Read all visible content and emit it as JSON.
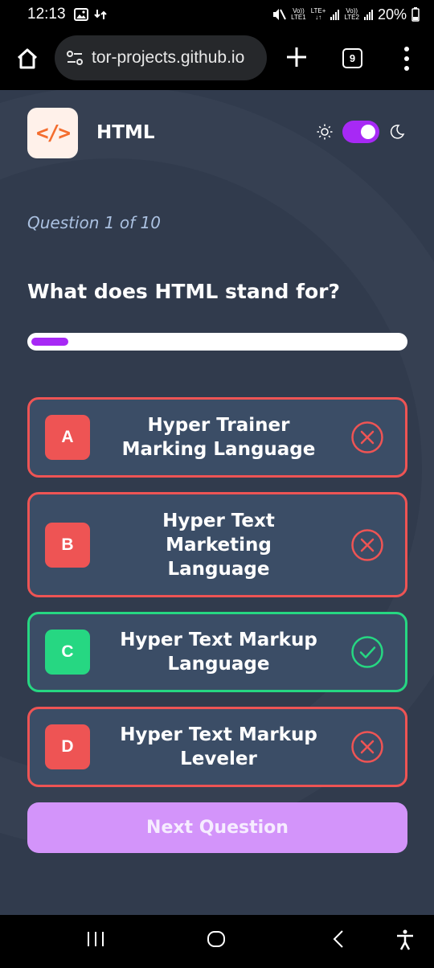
{
  "status_bar": {
    "time": "12:13",
    "sim1_top": "Vo))",
    "sim1_bottom": "LTE1",
    "net_top": "LTE+",
    "net_bottom": "↓↑",
    "sim2_top": "Vo))",
    "sim2_bottom": "LTE2",
    "battery": "20%"
  },
  "browser": {
    "url": "tor-projects.github.io",
    "tab_count": "9"
  },
  "app": {
    "logo_glyph": "</>",
    "subject": "HTML",
    "accent_color": "#a729f5",
    "theme_dark": true
  },
  "quiz": {
    "counter": "Question 1 of 10",
    "question": "What does HTML stand for?",
    "progress": 0.1,
    "options": [
      {
        "letter": "A",
        "text": "Hyper Trainer Marking Language",
        "state": "wrong"
      },
      {
        "letter": "B",
        "text": "Hyper Text Marketing Language",
        "state": "wrong"
      },
      {
        "letter": "C",
        "text": "Hyper Text Markup Language",
        "state": "correct"
      },
      {
        "letter": "D",
        "text": "Hyper Text Markup Leveler",
        "state": "wrong"
      }
    ],
    "next_label": "Next Question"
  },
  "colors": {
    "correct": "#26d782",
    "wrong": "#ee5454",
    "background": "#313b4d",
    "card": "#3b4d66"
  }
}
